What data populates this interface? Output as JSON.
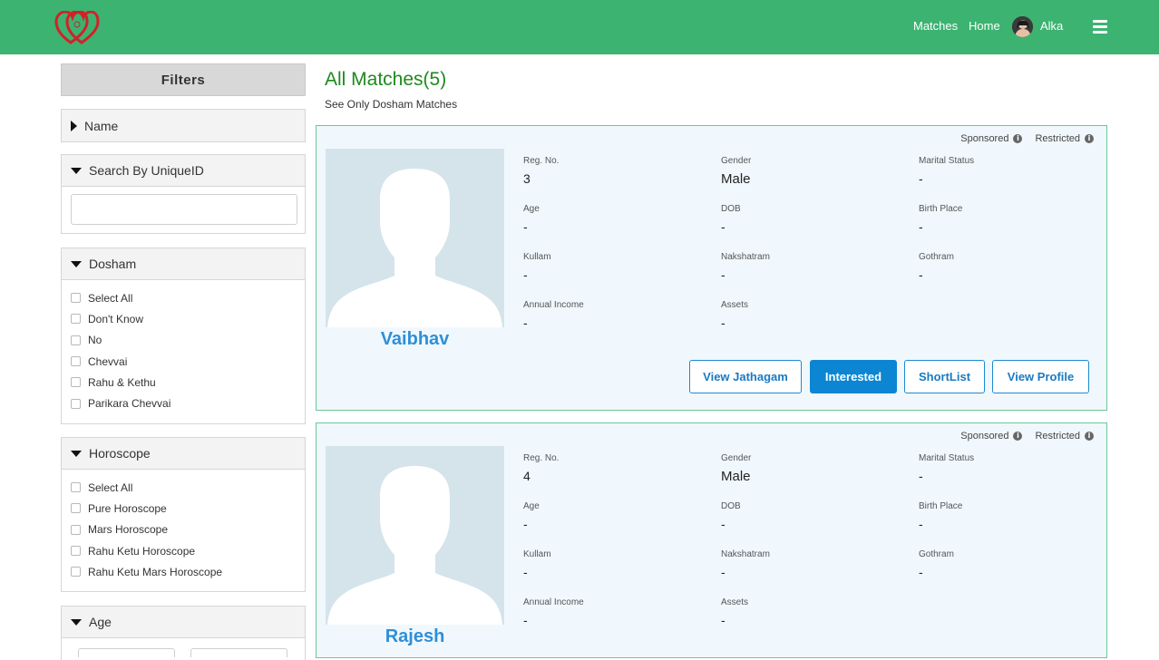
{
  "nav": {
    "matches": "Matches",
    "home": "Home",
    "user": "Alka"
  },
  "sidebar": {
    "title": "Filters",
    "name_panel": {
      "title": "Name"
    },
    "uniqueid_panel": {
      "title": "Search By UniqueID",
      "value": ""
    },
    "dosham_panel": {
      "title": "Dosham",
      "options": [
        "Select All",
        "Don't Know",
        "No",
        "Chevvai",
        "Rahu & Kethu",
        "Parikara Chevvai"
      ]
    },
    "horoscope_panel": {
      "title": "Horoscope",
      "options": [
        "Select All",
        "Pure Horoscope",
        "Mars Horoscope",
        "Rahu Ketu Horoscope",
        "Rahu Ketu Mars Horoscope"
      ]
    },
    "age_panel": {
      "title": "Age"
    }
  },
  "main": {
    "title": "All Matches(5)",
    "subtitle": "See Only Dosham Matches"
  },
  "labels": {
    "sponsored": "Sponsored",
    "restricted": "Restricted",
    "reg_no": "Reg. No.",
    "gender": "Gender",
    "marital_status": "Marital Status",
    "age": "Age",
    "dob": "DOB",
    "birth_place": "Birth Place",
    "kullam": "Kullam",
    "nakshatram": "Nakshatram",
    "gothram": "Gothram",
    "annual_income": "Annual Income",
    "assets": "Assets"
  },
  "buttons": {
    "view_jathagam": "View Jathagam",
    "interested": "Interested",
    "shortlist": "ShortList",
    "view_profile": "View Profile"
  },
  "matches": [
    {
      "name": "Vaibhav",
      "reg_no": "3",
      "gender": "Male",
      "marital_status": "-",
      "age": "-",
      "dob": "-",
      "birth_place": "-",
      "kullam": "-",
      "nakshatram": "-",
      "gothram": "-",
      "annual_income": "-",
      "assets": "-"
    },
    {
      "name": "Rajesh",
      "reg_no": "4",
      "gender": "Male",
      "marital_status": "-",
      "age": "-",
      "dob": "-",
      "birth_place": "-",
      "kullam": "-",
      "nakshatram": "-",
      "gothram": "-",
      "annual_income": "-",
      "assets": "-"
    }
  ],
  "colors": {
    "topbar": "#3cb371",
    "title": "#1e8a1e",
    "accent": "#0c86d2",
    "name": "#2e8fd8",
    "card_bg": "#f0f8fd",
    "card_border": "#6cc79a"
  },
  "icons": [
    "heart-logo-icon",
    "hamburger-menu-icon",
    "info-icon",
    "user-avatar",
    "person-silhouette-icon"
  ]
}
